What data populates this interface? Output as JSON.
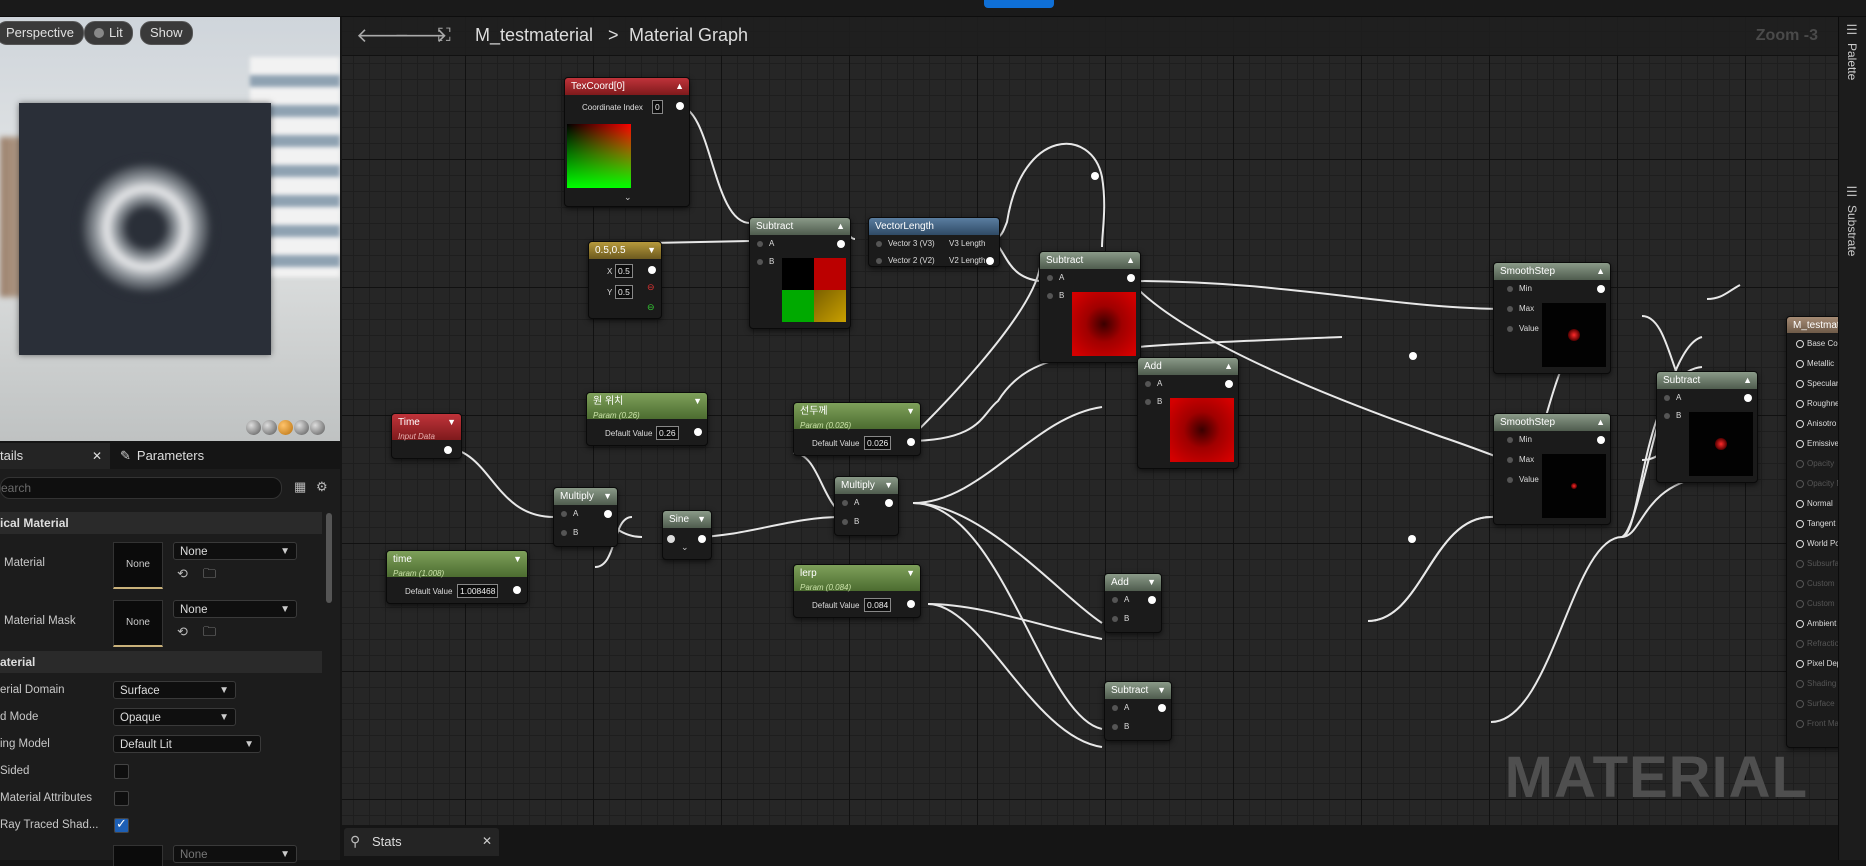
{
  "viewport": {
    "perspective_label": "Perspective",
    "lit_label": "Lit",
    "show_label": "Show"
  },
  "details": {
    "tab_details": "tails",
    "tab_parameters": "Parameters",
    "search_placeholder": "earch",
    "section_physical": "ical Material",
    "phys_material_label": "Material",
    "phys_material_thumb": "None",
    "phys_material_value": "None",
    "phys_mask_label": "Material Mask",
    "phys_mask_thumb": "None",
    "phys_mask_value": "None",
    "section_material": "aterial",
    "domain_label": "erial Domain",
    "domain_value": "Surface",
    "blend_label": "d Mode",
    "blend_value": "Opaque",
    "shading_label": "ing Model",
    "shading_value": "Default Lit",
    "two_sided_label": "Sided",
    "attributes_label": "Material Attributes",
    "raytraced_label": "Ray Traced Shad...",
    "last_value": "None"
  },
  "graph": {
    "asset_name": "M_testmaterial",
    "separator": ">",
    "graph_name": "Material Graph",
    "zoom": "Zoom -3",
    "watermark": "MATERIAL"
  },
  "nodes": {
    "texcoord": {
      "title": "TexCoord[0]",
      "index_label": "Coordinate Index",
      "index_value": "0"
    },
    "const2": {
      "title": "0.5,0.5",
      "x_label": "X",
      "x_value": "0.5",
      "y_label": "Y",
      "y_value": "0.5"
    },
    "subtract1": {
      "title": "Subtract",
      "a": "A",
      "b": "B"
    },
    "vectorlength": {
      "title": "VectorLength",
      "in1": "Vector 3 (V3)",
      "out1": "V3 Length",
      "in2": "Vector 2 (V2)",
      "out2": "V2 Length"
    },
    "subtract2": {
      "title": "Subtract",
      "a": "A",
      "b": "B"
    },
    "add1": {
      "title": "Add",
      "a": "A",
      "b": "B"
    },
    "smoothstep1": {
      "title": "SmoothStep",
      "min": "Min",
      "max": "Max",
      "value": "Value"
    },
    "smoothstep2": {
      "title": "SmoothStep",
      "min": "Min",
      "max": "Max",
      "value": "Value"
    },
    "subtract3": {
      "title": "Subtract",
      "a": "A",
      "b": "B"
    },
    "time": {
      "title": "Time",
      "sub": "Input Data"
    },
    "param_pos": {
      "title": "원 위치",
      "sub": "Param (0.26)",
      "label": "Default Value",
      "value": "0.26"
    },
    "param_thick": {
      "title": "선두께",
      "sub": "Param (0.026)",
      "label": "Default Value",
      "value": "0.026"
    },
    "param_time": {
      "title": "time",
      "sub": "Param (1.008)",
      "label": "Default Value",
      "value": "1.008468"
    },
    "multiply1": {
      "title": "Multiply",
      "a": "A",
      "b": "B"
    },
    "sine": {
      "title": "Sine"
    },
    "multiply2": {
      "title": "Multiply",
      "a": "A",
      "b": "B"
    },
    "lerp": {
      "title": "lerp",
      "sub": "Param (0.084)",
      "label": "Default Value",
      "value": "0.084"
    },
    "add2": {
      "title": "Add",
      "a": "A",
      "b": "B"
    },
    "subtract4": {
      "title": "Subtract",
      "a": "A",
      "b": "B"
    },
    "result": {
      "title": "M_testmat",
      "pins": [
        {
          "label": "Base Col",
          "enabled": true
        },
        {
          "label": "Metallic",
          "enabled": true
        },
        {
          "label": "Specular",
          "enabled": true
        },
        {
          "label": "Roughne",
          "enabled": true
        },
        {
          "label": "Anisotro",
          "enabled": true
        },
        {
          "label": "Emissive",
          "enabled": true
        },
        {
          "label": "Opacity",
          "enabled": false
        },
        {
          "label": "Opacity M",
          "enabled": false
        },
        {
          "label": "Normal",
          "enabled": true
        },
        {
          "label": "Tangent",
          "enabled": true
        },
        {
          "label": "World Po",
          "enabled": true
        },
        {
          "label": "Subsurfa",
          "enabled": false
        },
        {
          "label": "Custom",
          "enabled": false
        },
        {
          "label": "Custom",
          "enabled": false
        },
        {
          "label": "Ambient",
          "enabled": true
        },
        {
          "label": "Refractio",
          "enabled": false
        },
        {
          "label": "Pixel Dep",
          "enabled": true
        },
        {
          "label": "Shading",
          "enabled": false
        },
        {
          "label": "Surface",
          "enabled": false
        },
        {
          "label": "Front Ma",
          "enabled": false
        }
      ]
    }
  },
  "right_tabs": {
    "palette": "Palette",
    "substrate": "Substrate"
  },
  "stats": {
    "tab_label": "Stats"
  }
}
